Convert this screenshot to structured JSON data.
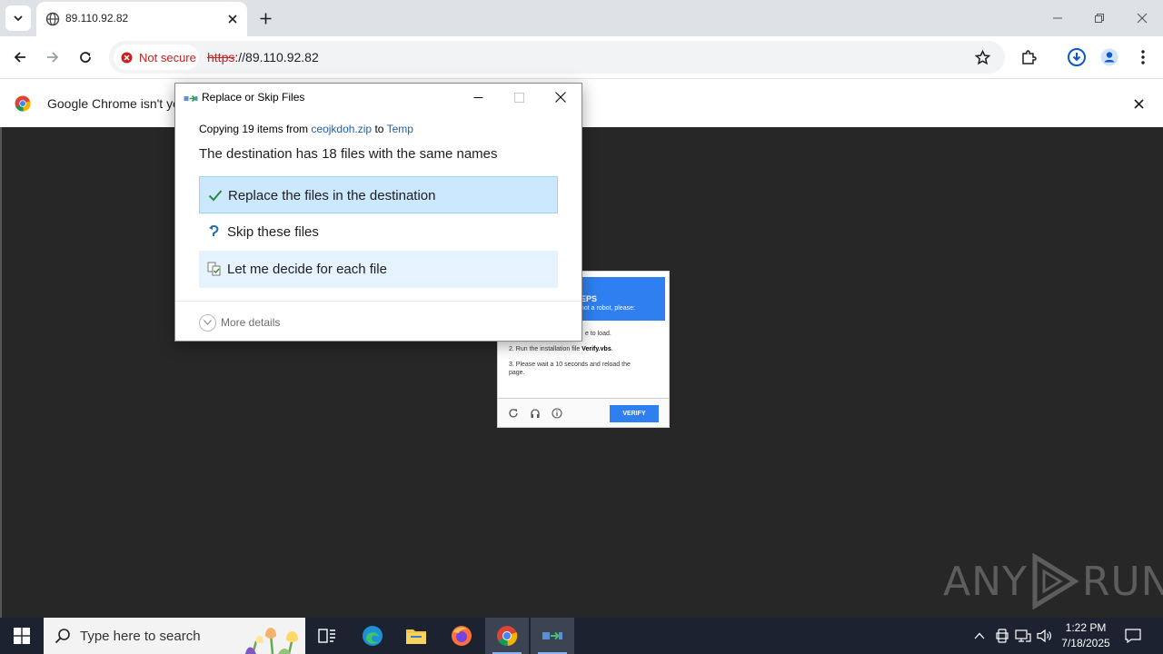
{
  "browser": {
    "tab_title": "89.110.92.82",
    "security_label": "Not secure",
    "url_scheme": "https",
    "url_rest": "://89.110.92.82",
    "infobar_text": "Google Chrome isn't you"
  },
  "dialog": {
    "title": "Replace or Skip Files",
    "copying_prefix": "Copying 19 items from ",
    "source_name": "ceojkdoh.zip",
    "copying_mid": " to ",
    "target_name": "Temp",
    "destination_line": "The destination has 18 files with the same names",
    "options": {
      "replace": "Replace the files in the destination",
      "skip": "Skip these files",
      "decide": "Let me decide for each file"
    },
    "more_details": "More details"
  },
  "captcha": {
    "heading": "EPS",
    "subheading": "not a robot, please:",
    "step1": "e to load.",
    "step2_prefix": "2. Run the installation file ",
    "step2_file": "Verify.vbs",
    "step2_suffix": ".",
    "step3": "3. Please wait a 10 seconds and reload the page.",
    "verify_label": "VERIFY"
  },
  "watermark": {
    "left": "ANY",
    "right": "RUN"
  },
  "taskbar": {
    "search_placeholder": "Type here to search",
    "time": "1:22 PM",
    "date": "7/18/2025"
  },
  "colors": {
    "accent_blue": "#2f7ff0",
    "insecure_red": "#c5221f",
    "option_selected": "#cce8ff",
    "page_background": "#272727",
    "taskbar": "#1c2230"
  }
}
